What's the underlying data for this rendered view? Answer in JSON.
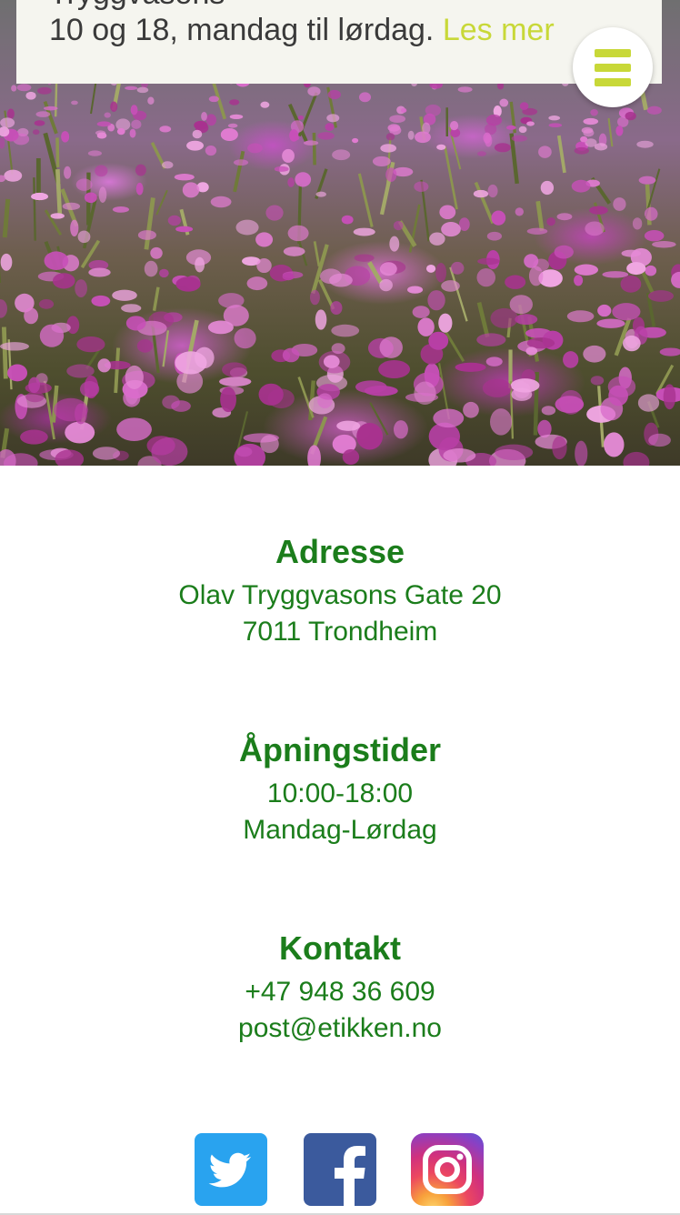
{
  "banner": {
    "cut_text": "Tryggvasons",
    "text": "10 og 18, mandag til lørdag.",
    "more_link": "Les mer"
  },
  "menu": {
    "icon": "hamburger-icon"
  },
  "address": {
    "heading": "Adresse",
    "line1": "Olav Tryggvasons Gate 20",
    "line2": "7011 Trondheim"
  },
  "hours": {
    "heading": "Åpningstider",
    "line1": "10:00-18:00",
    "line2": "Mandag-Lørdag"
  },
  "contact": {
    "heading": "Kontakt",
    "phone": "+47 948 36 609",
    "email": "post@etikken.no"
  },
  "social": [
    {
      "name": "twitter",
      "icon": "twitter-icon",
      "color": "#29a3ef"
    },
    {
      "name": "facebook",
      "icon": "facebook-icon",
      "color": "#3b5a9d"
    },
    {
      "name": "instagram",
      "icon": "instagram-icon",
      "color": "#d0307e"
    }
  ],
  "colors": {
    "heading_green": "#1b7d1b",
    "accent_lime": "#c8d838",
    "banner_bg": "#f5f5ef"
  }
}
